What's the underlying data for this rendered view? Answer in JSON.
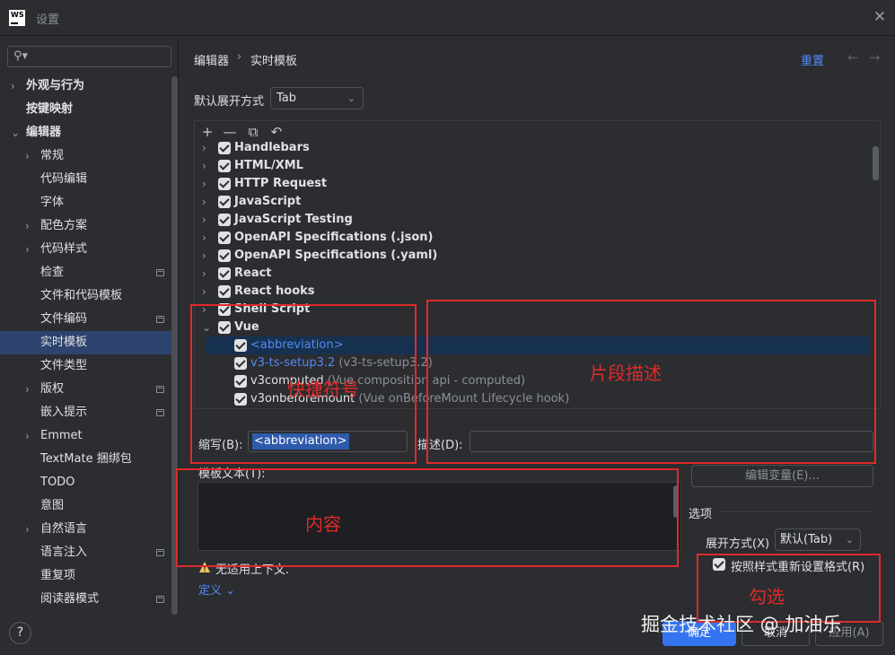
{
  "window": {
    "title": "设置",
    "logo_text": "WS"
  },
  "sidebar": {
    "search_placeholder": "",
    "items": [
      {
        "label": "外观与行为",
        "level": 0,
        "chevron": "›",
        "bold": true
      },
      {
        "label": "按键映射",
        "level": 0,
        "chevron": "",
        "bold": true
      },
      {
        "label": "编辑器",
        "level": 0,
        "chevron": "⌄",
        "bold": true
      },
      {
        "label": "常规",
        "level": 1,
        "chevron": "›"
      },
      {
        "label": "代码编辑",
        "level": 1,
        "chevron": ""
      },
      {
        "label": "字体",
        "level": 1,
        "chevron": ""
      },
      {
        "label": "配色方案",
        "level": 1,
        "chevron": "›"
      },
      {
        "label": "代码样式",
        "level": 1,
        "chevron": "›"
      },
      {
        "label": "检查",
        "level": 1,
        "chevron": "",
        "pin": true
      },
      {
        "label": "文件和代码模板",
        "level": 1,
        "chevron": ""
      },
      {
        "label": "文件编码",
        "level": 1,
        "chevron": "",
        "pin": true
      },
      {
        "label": "实时模板",
        "level": 1,
        "chevron": "",
        "selected": true
      },
      {
        "label": "文件类型",
        "level": 1,
        "chevron": ""
      },
      {
        "label": "版权",
        "level": 1,
        "chevron": "›",
        "pin": true
      },
      {
        "label": "嵌入提示",
        "level": 1,
        "chevron": "",
        "pin": true
      },
      {
        "label": "Emmet",
        "level": 1,
        "chevron": "›"
      },
      {
        "label": "TextMate 捆绑包",
        "level": 1,
        "chevron": ""
      },
      {
        "label": "TODO",
        "level": 1,
        "chevron": ""
      },
      {
        "label": "意图",
        "level": 1,
        "chevron": ""
      },
      {
        "label": "自然语言",
        "level": 1,
        "chevron": "›"
      },
      {
        "label": "语言注入",
        "level": 1,
        "chevron": "",
        "pin": true
      },
      {
        "label": "重复项",
        "level": 1,
        "chevron": ""
      },
      {
        "label": "阅读器模式",
        "level": 1,
        "chevron": "",
        "pin": true
      }
    ]
  },
  "header": {
    "breadcrumb_1": "编辑器",
    "breadcrumb_sep": "›",
    "breadcrumb_2": "实时模板",
    "reset_label": "重置",
    "back_arrow": "←",
    "forward_arrow": "→"
  },
  "expand": {
    "label": "默认展开方式",
    "value": "Tab"
  },
  "toolbar": {
    "add": "+",
    "remove": "—",
    "copy": "⧉",
    "restore": "↶"
  },
  "groups": [
    {
      "name": "Handlebars",
      "expanded": false
    },
    {
      "name": "HTML/XML",
      "expanded": false
    },
    {
      "name": "HTTP Request",
      "expanded": false
    },
    {
      "name": "JavaScript",
      "expanded": false
    },
    {
      "name": "JavaScript Testing",
      "expanded": false
    },
    {
      "name": "OpenAPI Specifications (.json)",
      "expanded": false
    },
    {
      "name": "OpenAPI Specifications (.yaml)",
      "expanded": false
    },
    {
      "name": "React",
      "expanded": false
    },
    {
      "name": "React hooks",
      "expanded": false
    },
    {
      "name": "Shell Script",
      "expanded": false
    },
    {
      "name": "Vue",
      "expanded": true
    }
  ],
  "vue_templates": [
    {
      "abbr": "<abbreviation>",
      "desc": "",
      "selected": true
    },
    {
      "abbr": "v3-ts-setup3.2",
      "desc": "(v3-ts-setup3.2)",
      "selected": false
    },
    {
      "abbr": "v3computed",
      "desc": "(Vue composition api - computed)",
      "selected": false
    },
    {
      "abbr": "v3onbeforemount",
      "desc": "(Vue onBeforeMount Lifecycle hook)",
      "selected": false
    }
  ],
  "abbreviation": {
    "label": "缩写(B):",
    "value": "<abbreviation>"
  },
  "description": {
    "label": "描述(D):",
    "value": ""
  },
  "template_text": {
    "label": "模板文本(T):",
    "value": ""
  },
  "edit_variables_label": "编辑变量(E)...",
  "options": {
    "section_label": "选项",
    "expand_with_label": "展开方式(X)",
    "expand_with_value": "默认(Tab)",
    "reformat_label": "按照样式重新设置格式(R)",
    "reformat_checked": true
  },
  "warning": {
    "text": "无适用上下文.",
    "define_link": "定义"
  },
  "buttons": {
    "ok": "确定",
    "cancel": "取消",
    "apply": "应用(A)",
    "help": "?"
  },
  "annotations": {
    "shortcut": "快捷符号",
    "snippet_desc": "片段描述",
    "content": "内容",
    "check": "勾选"
  },
  "watermark": "掘金技术社区 @ 加油乐",
  "colors": {
    "accent": "#3574f0",
    "link": "#548af7",
    "annotation": "#e02a2a",
    "selection": "#2e436e"
  }
}
